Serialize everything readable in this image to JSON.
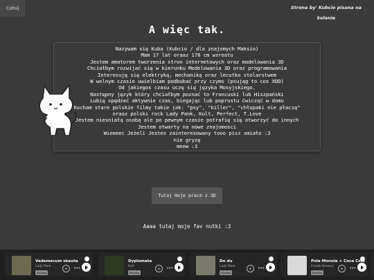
{
  "nav": {
    "back_label": "Cofnij"
  },
  "credit": {
    "text": "Strona by' Kubcio pisana na kolanie"
  },
  "heading": {
    "title": "A więc tak."
  },
  "about": {
    "lines": [
      "Nazywam się Kuba (Kubcio / dla znajomych Maksio)",
      "Mam 17 lat oraaz 178 cm wzrostu",
      "Jestem amatorem tworzenia stron internetowych oraz modelowania 3D",
      "Chciałbym rozwijać się w kierunku Modelowania 3D oraz programowania",
      "Interesuję się elektryką, mechaniką oraz lecutko stolarstwem",
      "W wolnym czasie uwielbiam podbubać przy czyms (psująg to cos XDD)",
      "Od jakiegos czasu uczę się języka Mosyjskiego.",
      "Następny język który chciałbym poznać to Francuski lub Hiszpański",
      "Lubię spędzać aktywnie czas, biegając lub poprostu ćwicząć w domu",
      "Kocham stare polskie filmy takie jak: \"psy\", \"killer\", \"chłopaki nie płaczą\"",
      "oraaz polski rock Lady Pank, Kult, Perfect, T.Love",
      "Jestem niesniałą osobą ale po pewnym czasie potrafię się otworzyć do innych",
      "Jestem otwarty na nowe znajomosci",
      "Wieeeec Jeżeli Jestes zainteresowany tooo pisz smiało :3",
      "nie gryzę",
      "meow :3"
    ]
  },
  "projects": {
    "button_label": "Tutaj moje prace z 3D"
  },
  "favorites": {
    "heading": "Aaaa tutaj moje fav nutki :3"
  },
  "players": {
    "preview_label": "Preview",
    "tracks": [
      {
        "title": "Vademecum skauta",
        "artist": "Lady Pank",
        "cover_color": "#6e6a52"
      },
      {
        "title": "Dyplomata",
        "artist": "Kult",
        "cover_color": "#2c3a22"
      },
      {
        "title": "Do du",
        "artist": "Lady Pank",
        "cover_color": "#7a7a6c"
      },
      {
        "title": "Pola Monola + Coca Cola",
        "artist": "Franek Kimono",
        "cover_color": "#d9d9d9"
      }
    ]
  }
}
